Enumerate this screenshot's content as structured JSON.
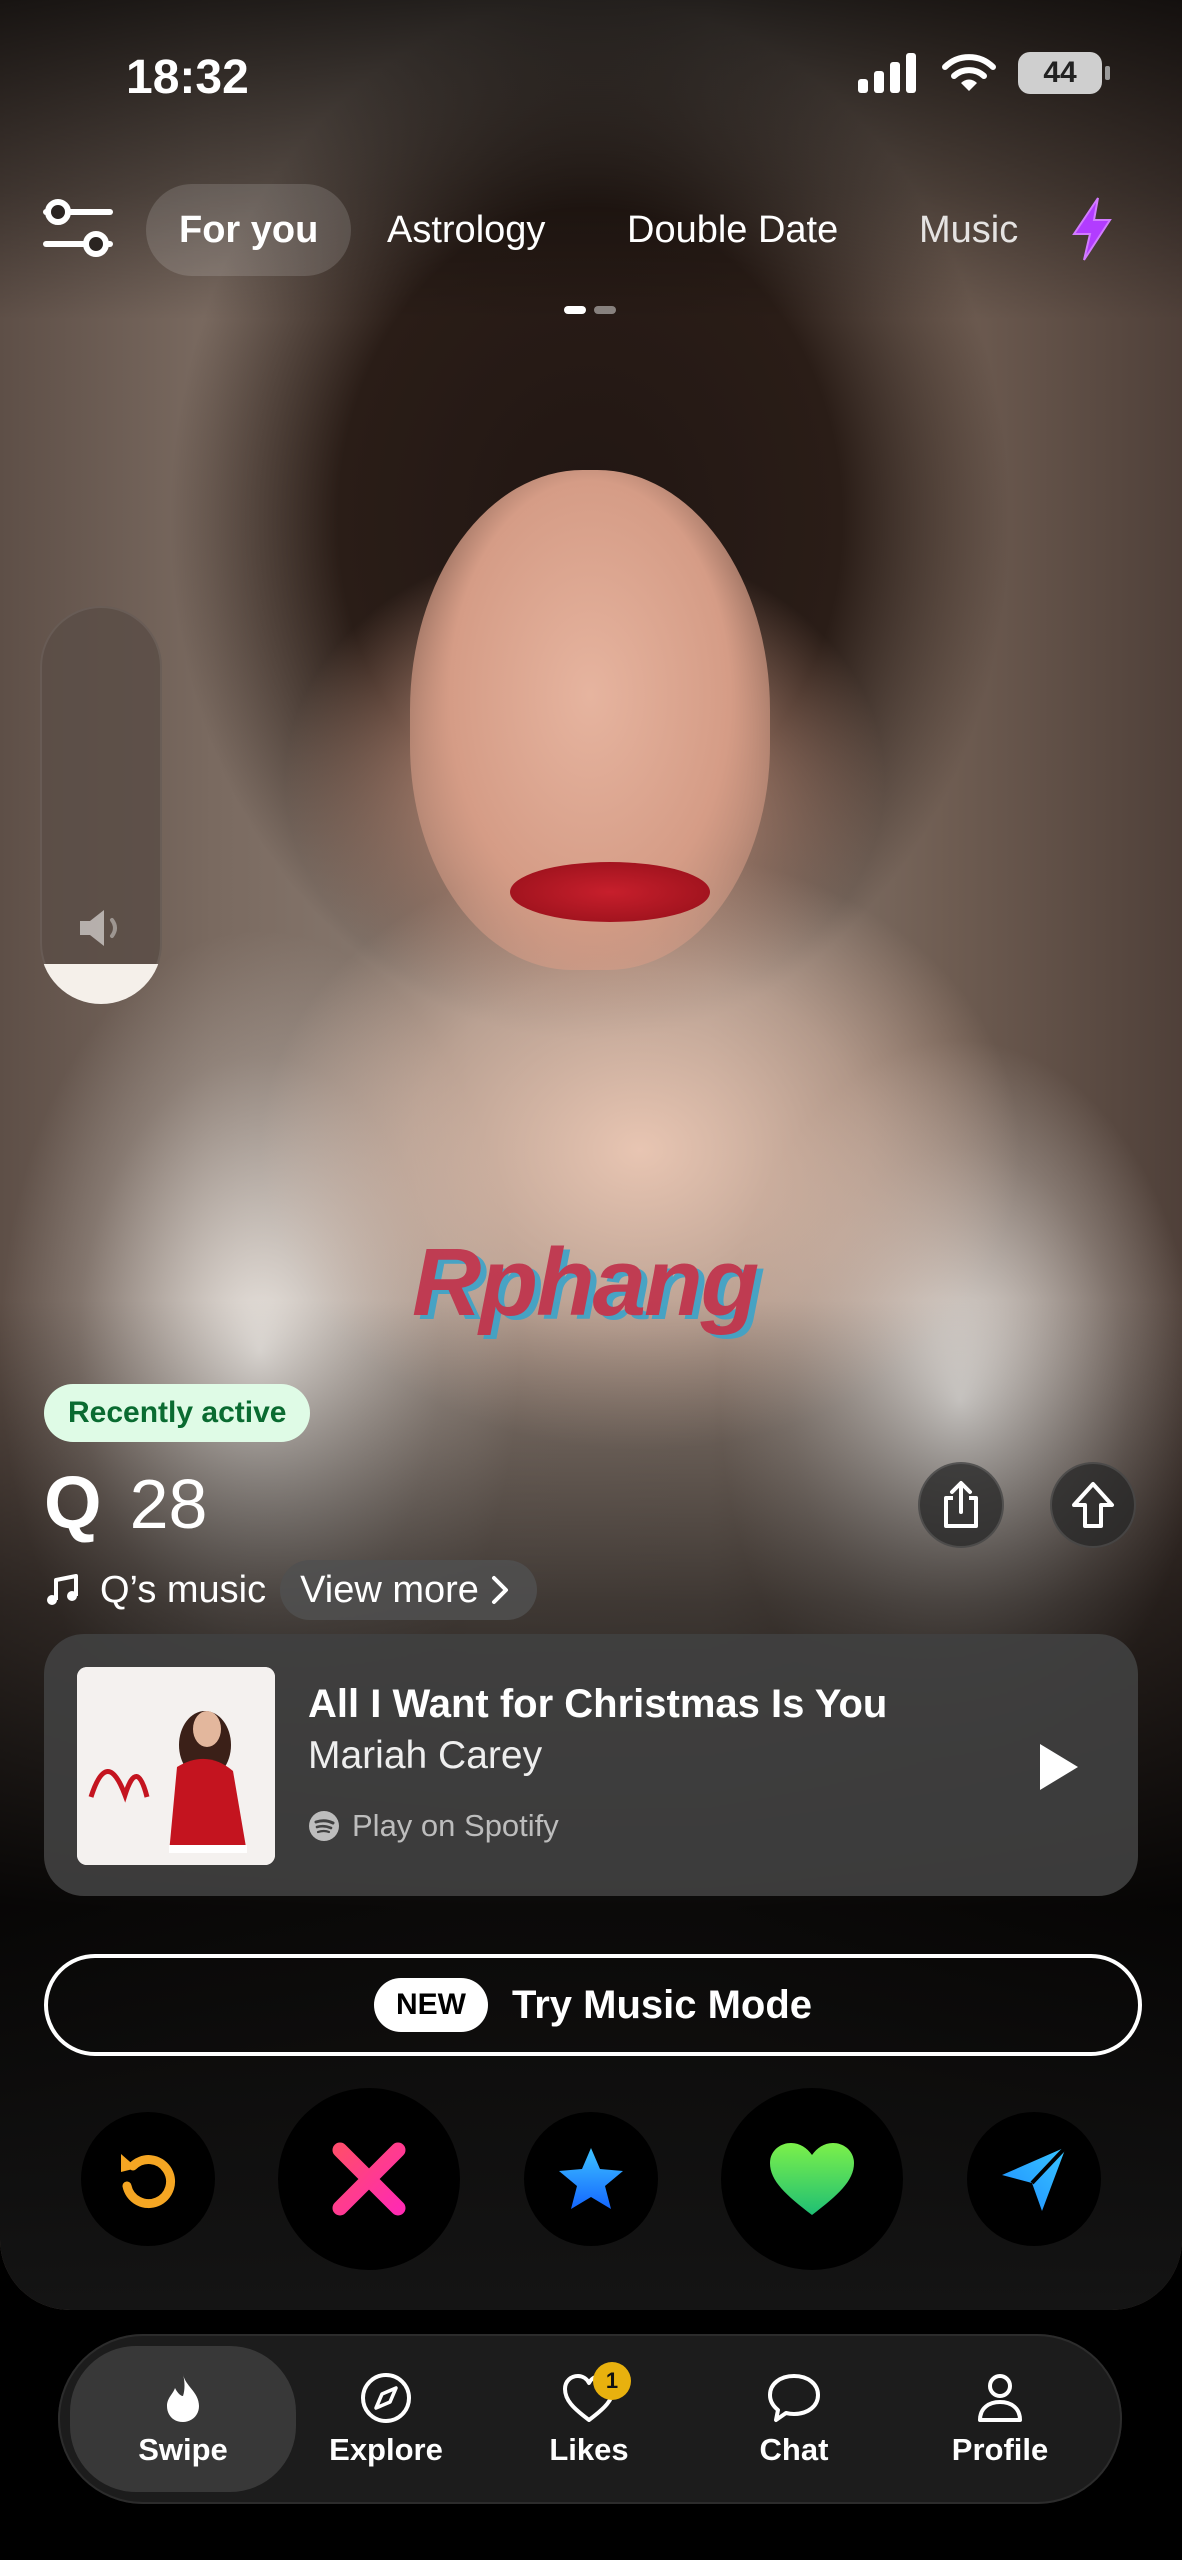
{
  "status_bar": {
    "time": "18:32",
    "battery": "44"
  },
  "tabs": [
    {
      "label": "For you",
      "active": true
    },
    {
      "label": "Astrology",
      "active": false
    },
    {
      "label": "Double Date",
      "active": false
    },
    {
      "label": "Music",
      "active": false
    }
  ],
  "photo_indicator": {
    "total": 2,
    "current": 1
  },
  "volume": {
    "level": 0.1
  },
  "watermark": "Rphang",
  "profile": {
    "badge": "Recently active",
    "name": "Q",
    "age": "28",
    "music_label": "Q’s music",
    "view_more": "View more"
  },
  "song": {
    "title": "All I Want for Christmas Is You",
    "artist": "Mariah Carey",
    "spotify": "Play on Spotify"
  },
  "music_mode": {
    "new": "NEW",
    "label": "Try Music Mode"
  },
  "actions": [
    "rewind-icon",
    "nope-icon",
    "super-like-icon",
    "like-icon",
    "message-icon"
  ],
  "nav": [
    {
      "label": "Swipe",
      "active": true
    },
    {
      "label": "Explore",
      "active": false
    },
    {
      "label": "Likes",
      "active": false,
      "badge": "1"
    },
    {
      "label": "Chat",
      "active": false
    },
    {
      "label": "Profile",
      "active": false
    }
  ],
  "colors": {
    "badge_bg": "#dffbe6",
    "badge_text": "#0a6b31",
    "nope": "#ff2e7e",
    "superlike": "#1f9bff",
    "like": "#6fdc3a",
    "rewind": "#f5a623",
    "boost": "#b23cff"
  }
}
